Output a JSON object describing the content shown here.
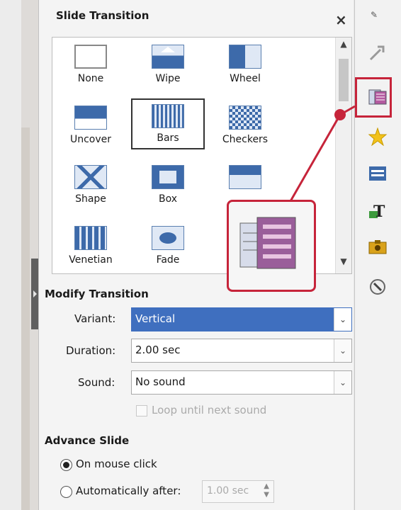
{
  "panel": {
    "title": "Slide Transition",
    "close_glyph": "×",
    "transitions": [
      {
        "label": "None",
        "icon": "none-transition-icon"
      },
      {
        "label": "Wipe",
        "icon": "wipe-transition-icon"
      },
      {
        "label": "Wheel",
        "icon": "wheel-transition-icon"
      },
      {
        "label": "Uncover",
        "icon": "uncover-transition-icon"
      },
      {
        "label": "Bars",
        "icon": "bars-transition-icon",
        "selected": true
      },
      {
        "label": "Checkers",
        "icon": "checkers-transition-icon"
      },
      {
        "label": "Shape",
        "icon": "shape-transition-icon"
      },
      {
        "label": "Box",
        "icon": "box-transition-icon"
      },
      {
        "label": "",
        "icon": "partially-hidden-transition-icon"
      },
      {
        "label": "Venetian",
        "icon": "venetian-transition-icon"
      },
      {
        "label": "Fade",
        "icon": "fade-transition-icon"
      }
    ]
  },
  "modify": {
    "title": "Modify Transition",
    "variant_label": "Variant:",
    "variant_value": "Vertical",
    "duration_label": "Duration:",
    "duration_value": "2.00 sec",
    "sound_label": "Sound:",
    "sound_value": "No sound",
    "loop_label": "Loop until next sound"
  },
  "advance": {
    "title": "Advance Slide",
    "mouse_label": "On mouse click",
    "auto_label": "Automatically after:",
    "auto_value": "1.00 sec"
  },
  "sidebar": {
    "icons": [
      "properties-icon",
      "slide-transition-icon",
      "animation-icon",
      "master-slides-icon",
      "styles-icon",
      "gallery-icon",
      "navigator-icon"
    ]
  },
  "colors": {
    "highlight": "#c6243a",
    "selection": "#3f6fbf"
  }
}
